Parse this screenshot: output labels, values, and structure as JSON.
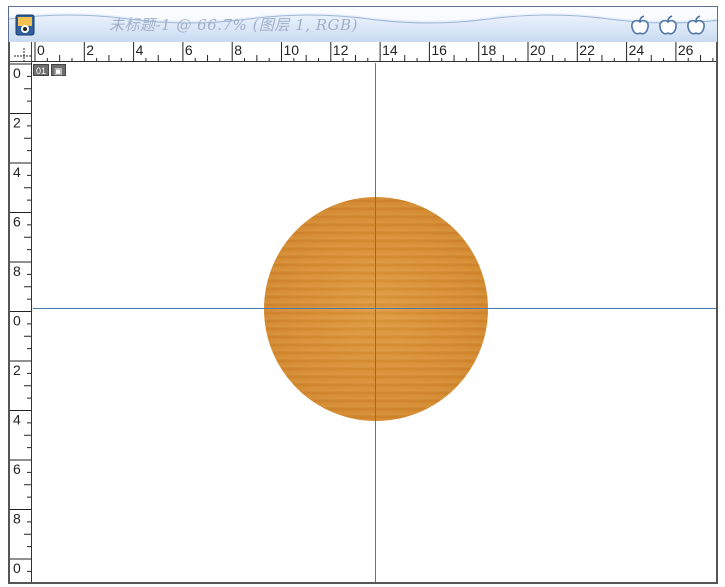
{
  "window": {
    "title": "未标题-1 @ 66.7% (图层 1, RGB)"
  },
  "badges": {
    "layer": "01",
    "image": "▣"
  },
  "h_ruler": {
    "labels": [
      "0",
      "2",
      "4",
      "6",
      "8",
      "10",
      "12",
      "14",
      "16",
      "18",
      "20",
      "22",
      "24",
      "26"
    ]
  },
  "v_ruler": {
    "labels": [
      "0",
      "2",
      "4",
      "6",
      "8",
      "0",
      "2",
      "4",
      "6",
      "8",
      "0"
    ]
  },
  "canvas": {
    "shape": "wood-textured circle",
    "fill_color": "#d88f34",
    "guide_color": "#4a78b0"
  },
  "icons": {
    "app": "photoshop-doc-icon",
    "title_buttons": [
      "apple-icon",
      "apple-icon",
      "apple-icon"
    ]
  }
}
